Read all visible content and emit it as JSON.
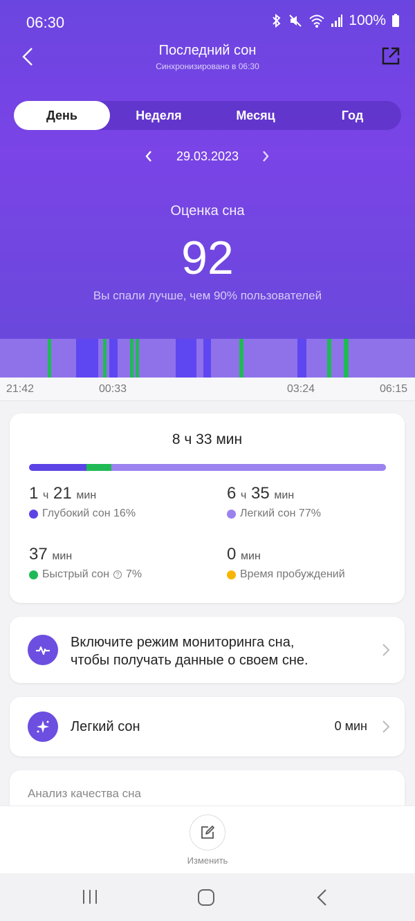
{
  "status_bar": {
    "time": "06:30",
    "battery": "100%"
  },
  "nav": {
    "title": "Последний сон",
    "subtitle": "Синхронизировано в 06:30"
  },
  "tabs": [
    {
      "label": "День",
      "active": true
    },
    {
      "label": "Неделя",
      "active": false
    },
    {
      "label": "Месяц",
      "active": false
    },
    {
      "label": "Год",
      "active": false
    }
  ],
  "date": "29.03.2023",
  "score": {
    "label": "Оценка сна",
    "value": "92",
    "comparison": "Вы спали лучше, чем 90% пользователей"
  },
  "timeline": {
    "ticks": [
      "21:42",
      "00:33",
      "03:24",
      "06:15"
    ],
    "stage_colors": {
      "light": "#8f72ea",
      "deep": "#5e47f0",
      "rem": "#1fba55"
    }
  },
  "summary": {
    "total": "8 ч 33 мин",
    "bar_fractions": {
      "deep": 0.16,
      "rem": 0.07,
      "light": 0.77
    },
    "deep": {
      "h": "1",
      "h_unit": "ч",
      "m": "21",
      "m_unit": "мин",
      "label": "Глубокий сон 16%"
    },
    "light": {
      "h": "6",
      "h_unit": "ч",
      "m": "35",
      "m_unit": "мин",
      "label": "Легкий сон 77%"
    },
    "rem": {
      "m": "37",
      "m_unit": "мин",
      "label": "Быстрый сон",
      "pct": "7%"
    },
    "awake": {
      "m": "0",
      "m_unit": "мин",
      "label": "Время пробуждений"
    },
    "colors": {
      "deep": "#5b43e6",
      "light": "#9b82ee",
      "rem": "#1fba55",
      "awake": "#f7b500"
    }
  },
  "monitor_card": {
    "line1": "Включите режим мониторинга сна,",
    "line2": "чтобы получать данные о своем сне."
  },
  "light_card": {
    "label": "Легкий сон",
    "value": "0 мин"
  },
  "analysis_card": {
    "title": "Анализ качества сна"
  },
  "bottom": {
    "edit_label": "Изменить"
  }
}
